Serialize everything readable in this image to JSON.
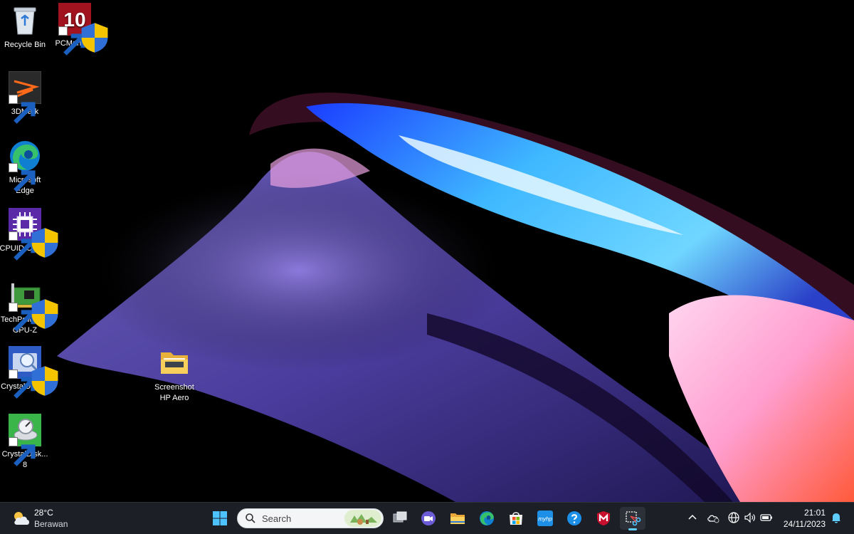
{
  "desktop_icons": [
    {
      "id": "recycle-bin",
      "label": "Recycle Bin",
      "icon": "recycle-bin-icon"
    },
    {
      "id": "pcmark",
      "label": "PCMark 10",
      "icon": "pcmark-icon",
      "icon_text": "10"
    },
    {
      "id": "3dmark",
      "label": "3DMark",
      "icon": "3dmark-icon"
    },
    {
      "id": "edge",
      "label": "Microsoft Edge",
      "icon": "edge-icon"
    },
    {
      "id": "cpuz",
      "label": "CPUID CPU-Z",
      "icon": "cpu-icon"
    },
    {
      "id": "gpuz",
      "label": "TechPowerUp GPU-Z",
      "icon": "gpu-icon"
    },
    {
      "id": "crystaldiskinfo",
      "label": "CrystalDiskI...",
      "icon": "crystaldiskinfo-icon"
    },
    {
      "id": "crystaldiskmark",
      "label": "CrystalDisk... 8",
      "icon": "crystaldiskmark-icon"
    },
    {
      "id": "folder",
      "label": "Screenshot HP Aero",
      "icon": "folder-icon"
    }
  ],
  "taskbar": {
    "weather": {
      "temp": "28°C",
      "condition": "Berawan",
      "icon": "partly-cloudy-icon"
    },
    "search": {
      "placeholder": "Search"
    },
    "apps": [
      {
        "id": "start",
        "icon": "windows-start-icon"
      },
      {
        "id": "task-view",
        "icon": "task-view-icon"
      },
      {
        "id": "teams",
        "icon": "teams-chat-icon"
      },
      {
        "id": "file-explorer",
        "icon": "folder-icon"
      },
      {
        "id": "edge",
        "icon": "edge-icon"
      },
      {
        "id": "store",
        "icon": "store-icon"
      },
      {
        "id": "myhp",
        "icon": "myhp-icon",
        "text": "myhp"
      },
      {
        "id": "help",
        "icon": "help-icon"
      },
      {
        "id": "mcafee",
        "icon": "mcafee-icon"
      },
      {
        "id": "snipping-tool",
        "icon": "snipping-tool-icon",
        "active": true
      }
    ],
    "tray": [
      "chevron-up-icon",
      "cloud-icon",
      "network-icon",
      "volume-icon",
      "battery-icon"
    ],
    "clock": {
      "time": "21:01",
      "date": "24/11/2023"
    },
    "notification_icon": "bell-icon"
  },
  "colors": {
    "taskbar_bg": "#1c1f26",
    "accent": "#60cdff",
    "wallpaper_base": "#000000"
  }
}
